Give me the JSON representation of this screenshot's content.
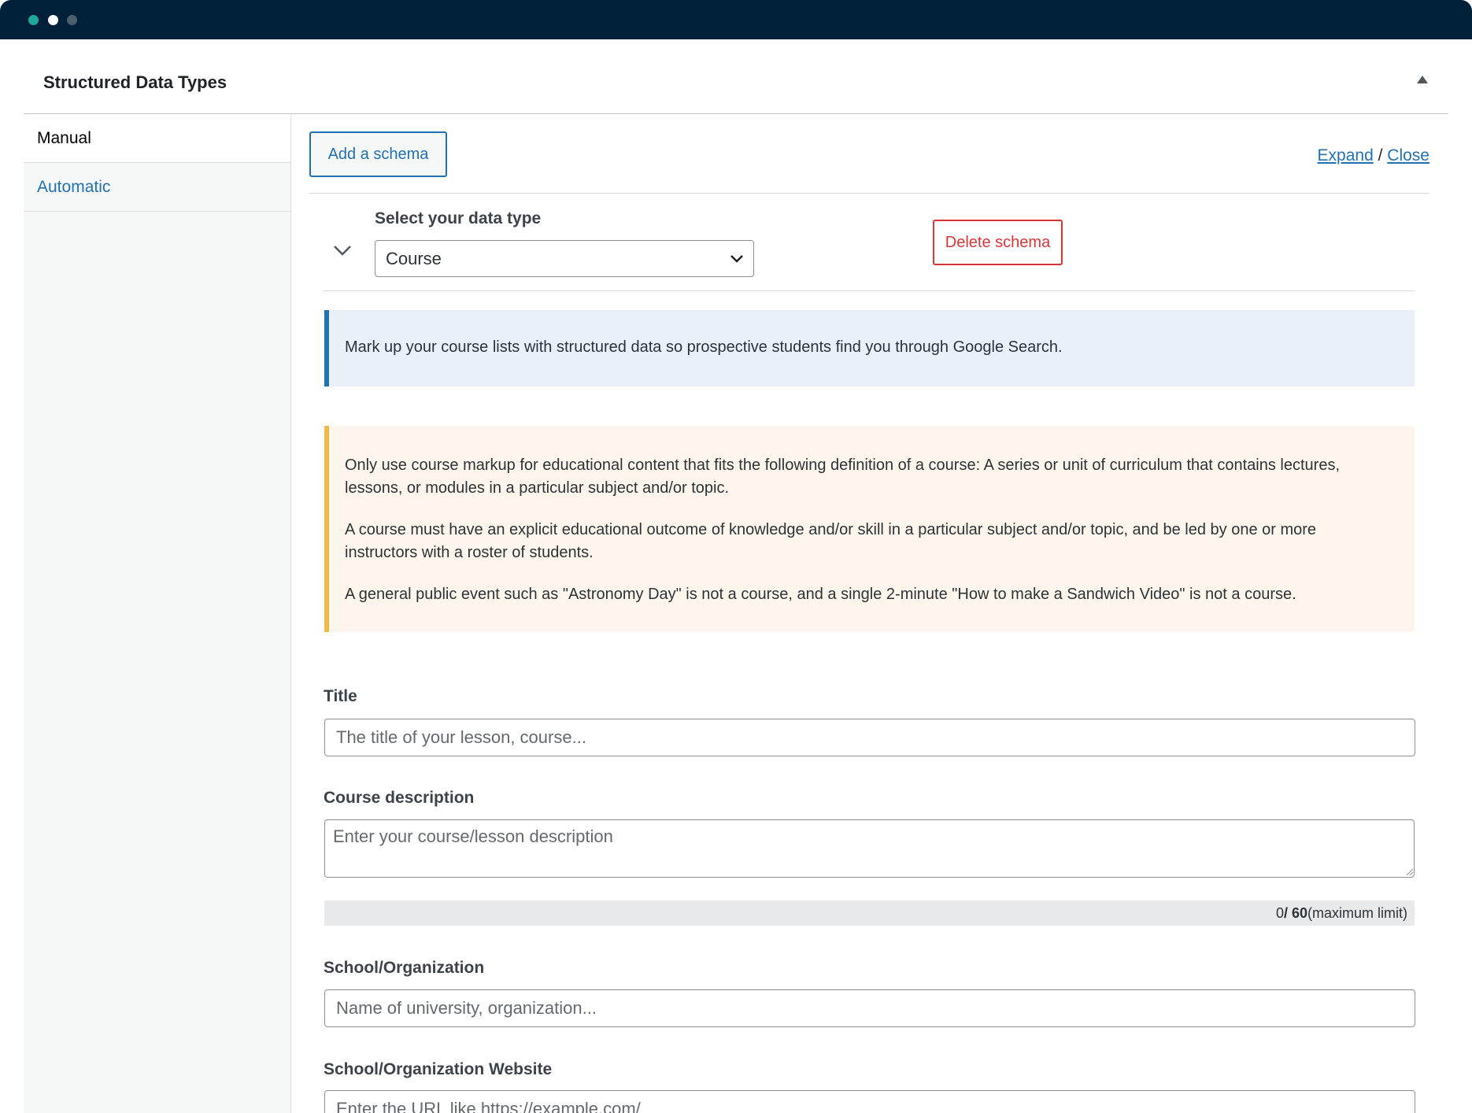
{
  "window": {
    "controls": [
      "close",
      "minimize",
      "maximize"
    ]
  },
  "panel": {
    "title": "Structured Data Types"
  },
  "sidebar": {
    "tabs": [
      {
        "label": "Manual",
        "active": true
      },
      {
        "label": "Automatic",
        "active": false
      }
    ]
  },
  "toolbar": {
    "add_label": "Add a schema",
    "expand_label": "Expand",
    "separator": "/",
    "close_label": "Close"
  },
  "schema": {
    "select_label": "Select your data type",
    "selected_type": "Course",
    "delete_label": "Delete schema"
  },
  "notices": {
    "info": "Mark up your course lists with structured data so prospective students find you through Google Search.",
    "warning": [
      "Only use course markup for educational content that fits the following definition of a course: A series or unit of curriculum that contains lectures, lessons, or modules in a particular subject and/or topic.",
      "A course must have an explicit educational outcome of knowledge and/or skill in a particular subject and/or topic, and be led by one or more instructors with a roster of students.",
      "A general public event such as \"Astronomy Day\" is not a course, and a single 2-minute \"How to make a Sandwich Video\" is not a course."
    ]
  },
  "fields": {
    "title": {
      "label": "Title",
      "placeholder": "The title of your lesson, course..."
    },
    "description": {
      "label": "Course description",
      "placeholder": "Enter your course/lesson description",
      "counter_current": "0",
      "counter_max": "/ 60",
      "counter_suffix": "(maximum limit)"
    },
    "organization": {
      "label": "School/Organization",
      "placeholder": "Name of university, organization..."
    },
    "website": {
      "label": "School/Organization Website",
      "placeholder": "Enter the URL like https://example.com/"
    }
  },
  "colors": {
    "accent": "#2271b1",
    "danger": "#d63638",
    "warning": "#f0b849",
    "titlebar": "#00203a"
  }
}
